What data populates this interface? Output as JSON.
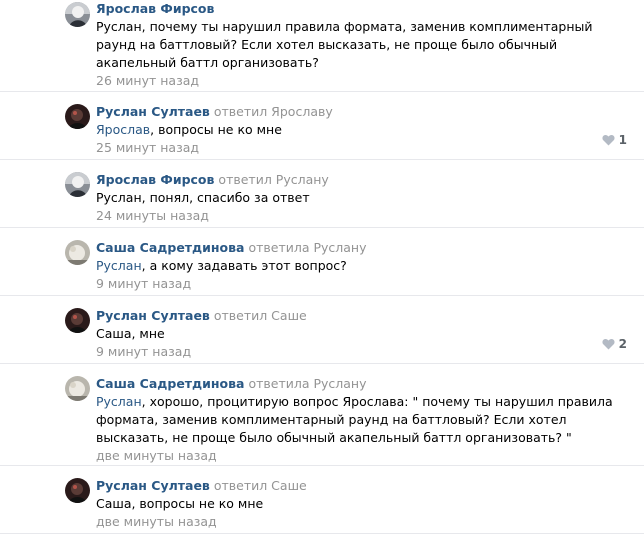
{
  "comments": [
    {
      "author": "Ярослав Фирсов",
      "reply_label": "",
      "mention": "",
      "text": "Руслан, почему ты нарушил правила формата, заменив комплиментарный раунд на баттловый? Если хотел высказать, не проще было обычный акапельный баттл организовать?",
      "date": "26 минут назад",
      "likes": ""
    },
    {
      "author": "Руслан Султаев",
      "reply_label": "ответил Ярославу",
      "mention": "Ярослав",
      "text": ", вопросы не ко мне",
      "date": "25 минут назад",
      "likes": "1"
    },
    {
      "author": "Ярослав Фирсов",
      "reply_label": "ответил Руслану",
      "mention": "",
      "text": "Руслан, понял, спасибо за ответ",
      "date": "24 минуты назад",
      "likes": ""
    },
    {
      "author": "Саша Садретдинова",
      "reply_label": "ответила Руслану",
      "mention": "Руслан",
      "text": ", а кому задавать этот вопрос?",
      "date": "9 минут назад",
      "likes": ""
    },
    {
      "author": "Руслан Султаев",
      "reply_label": "ответил Саше",
      "mention": "",
      "text": "Саша, мне",
      "date": "9 минут назад",
      "likes": "2"
    },
    {
      "author": "Саша Садретдинова",
      "reply_label": "ответила Руслану",
      "mention": "Руслан",
      "text": ", хорошо, процитирую вопрос Ярослава: \" почему ты нарушил правила формата, заменив комплиментарный раунд на баттловый? Если хотел высказать, не проще было обычный акапельный баттл организовать? \"",
      "date": "две минуты назад",
      "likes": ""
    },
    {
      "author": "Руслан Султаев",
      "reply_label": "ответил Саше",
      "mention": "",
      "text": "Саша, вопросы не ко мне",
      "date": "две минуты назад",
      "likes": ""
    }
  ],
  "icons": {
    "like": "heart-icon"
  },
  "colors": {
    "author": "#2a5885",
    "meta": "#939393",
    "divider": "#e7e8ec",
    "like_icon": "#b3bac4"
  }
}
